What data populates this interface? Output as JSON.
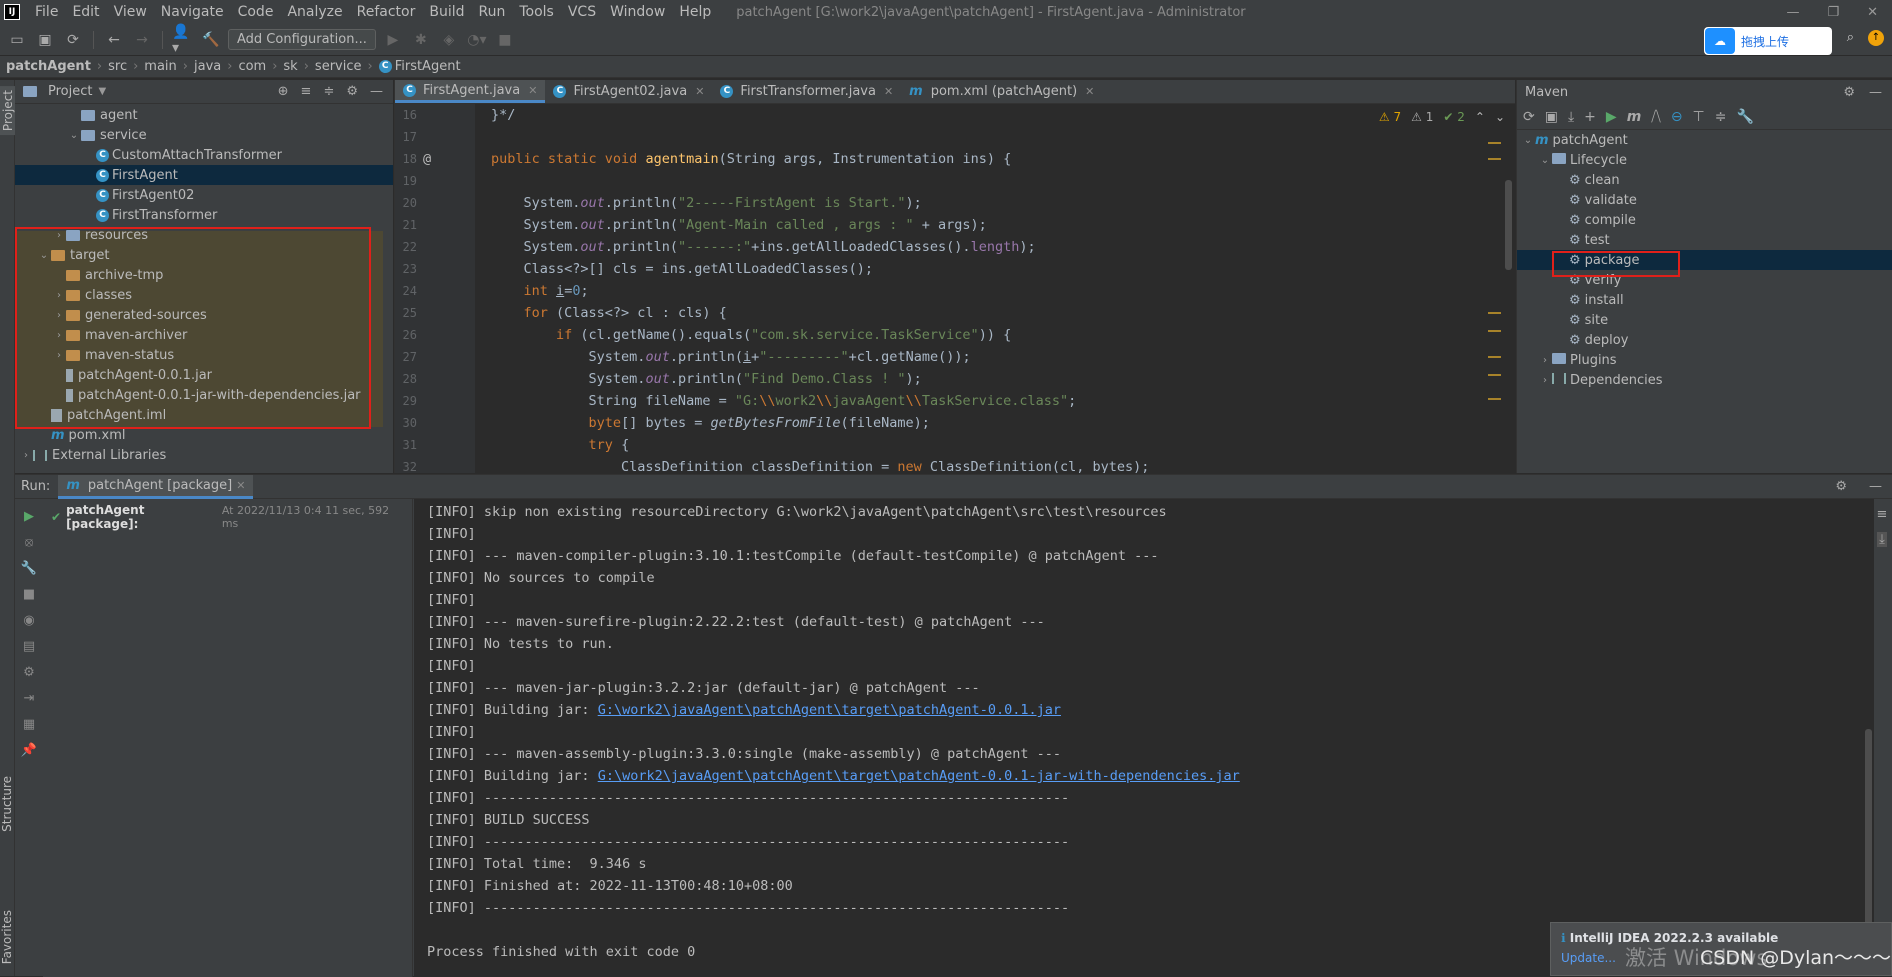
{
  "window": {
    "menu": [
      "File",
      "Edit",
      "View",
      "Navigate",
      "Code",
      "Analyze",
      "Refactor",
      "Build",
      "Run",
      "Tools",
      "VCS",
      "Window",
      "Help"
    ],
    "title": "patchAgent [G:\\work2\\javaAgent\\patchAgent] - FirstAgent.java - Administrator"
  },
  "toolbar": {
    "add_configuration": "Add Configuration...",
    "upload_label": "拖拽上传"
  },
  "breadcrumb": [
    "patchAgent",
    "src",
    "main",
    "java",
    "com",
    "sk",
    "service",
    "FirstAgent"
  ],
  "project": {
    "stripe_label": "Project",
    "title": "Project",
    "tree": [
      {
        "label": "agent",
        "indent": 2,
        "arrow": "",
        "icon": "folder-blue"
      },
      {
        "label": "service",
        "indent": 2,
        "arrow": "v",
        "icon": "folder-blue"
      },
      {
        "label": "CustomAttachTransformer",
        "indent": 3,
        "arrow": "",
        "icon": "class"
      },
      {
        "label": "FirstAgent",
        "indent": 3,
        "arrow": "",
        "icon": "class",
        "selected": true
      },
      {
        "label": "FirstAgent02",
        "indent": 3,
        "arrow": "",
        "icon": "class"
      },
      {
        "label": "FirstTransformer",
        "indent": 3,
        "arrow": "",
        "icon": "class"
      },
      {
        "label": "resources",
        "indent": 1,
        "arrow": ">",
        "icon": "folder-blue"
      },
      {
        "label": "target",
        "indent": 0,
        "arrow": "v",
        "icon": "folder"
      },
      {
        "label": "archive-tmp",
        "indent": 1,
        "arrow": "",
        "icon": "folder"
      },
      {
        "label": "classes",
        "indent": 1,
        "arrow": ">",
        "icon": "folder"
      },
      {
        "label": "generated-sources",
        "indent": 1,
        "arrow": ">",
        "icon": "folder"
      },
      {
        "label": "maven-archiver",
        "indent": 1,
        "arrow": ">",
        "icon": "folder"
      },
      {
        "label": "maven-status",
        "indent": 1,
        "arrow": ">",
        "icon": "folder"
      },
      {
        "label": "patchAgent-0.0.1.jar",
        "indent": 1,
        "arrow": "",
        "icon": "jar"
      },
      {
        "label": "patchAgent-0.0.1-jar-with-dependencies.jar",
        "indent": 1,
        "arrow": "",
        "icon": "jar"
      },
      {
        "label": "patchAgent.iml",
        "indent": 0,
        "arrow": "",
        "icon": "file"
      },
      {
        "label": "pom.xml",
        "indent": 0,
        "arrow": "",
        "icon": "maven"
      },
      {
        "label": "External Libraries",
        "indent": -1,
        "arrow": ">",
        "icon": "lib"
      }
    ]
  },
  "editor": {
    "tabs": [
      {
        "label": "FirstAgent.java",
        "icon": "C",
        "active": true
      },
      {
        "label": "FirstAgent02.java",
        "icon": "C",
        "active": false
      },
      {
        "label": "FirstTransformer.java",
        "icon": "C",
        "active": false
      },
      {
        "label": "pom.xml (patchAgent)",
        "icon": "m",
        "active": false
      }
    ],
    "inspections": {
      "warnings": "7",
      "weak": "1",
      "ok": "2"
    },
    "line_numbers": [
      "16",
      "17",
      "18",
      "19",
      "20",
      "21",
      "22",
      "23",
      "24",
      "25",
      "26",
      "27",
      "28",
      "29",
      "30",
      "31",
      "32"
    ]
  },
  "maven": {
    "title": "Maven",
    "project": "patchAgent",
    "lifecycle_label": "Lifecycle",
    "goals": [
      "clean",
      "validate",
      "compile",
      "test",
      "package",
      "verify",
      "install",
      "site",
      "deploy"
    ],
    "selected_goal": "package",
    "plugins_label": "Plugins",
    "dependencies_label": "Dependencies"
  },
  "run": {
    "label": "Run:",
    "tab": "patchAgent [package]",
    "tree_item": "patchAgent [package]:",
    "tree_time": "At 2022/11/13 0:4 11 sec, 592 ms",
    "console": [
      "[INFO] skip non existing resourceDirectory G:\\work2\\javaAgent\\patchAgent\\src\\test\\resources",
      "[INFO]",
      "[INFO] --- maven-compiler-plugin:3.10.1:testCompile (default-testCompile) @ patchAgent ---",
      "[INFO] No sources to compile",
      "[INFO]",
      "[INFO] --- maven-surefire-plugin:2.22.2:test (default-test) @ patchAgent ---",
      "[INFO] No tests to run.",
      "[INFO]",
      "[INFO] --- maven-jar-plugin:3.2.2:jar (default-jar) @ patchAgent ---",
      "[INFO] Building jar: ",
      "[INFO]",
      "[INFO] --- maven-assembly-plugin:3.3.0:single (make-assembly) @ patchAgent ---",
      "[INFO] Building jar: ",
      "[INFO] ------------------------------------------------------------------------",
      "[INFO] BUILD SUCCESS",
      "[INFO] ------------------------------------------------------------------------",
      "[INFO] Total time:  9.346 s",
      "[INFO] Finished at: 2022-11-13T00:48:10+08:00",
      "[INFO] ------------------------------------------------------------------------",
      "",
      "Process finished with exit code 0"
    ],
    "jar_link_1": "G:\\work2\\javaAgent\\patchAgent\\target\\patchAgent-0.0.1.jar",
    "jar_link_2": "G:\\work2\\javaAgent\\patchAgent\\target\\patchAgent-0.0.1-jar-with-dependencies.jar"
  },
  "side_labels": {
    "structure": "Structure",
    "favorites": "Favorites"
  },
  "notification": {
    "title": "IntelliJ IDEA 2022.2.3 available",
    "action": "Update..."
  },
  "watermark": "激活 Windows",
  "csdn": "CSDN @Dylan～～～",
  "colors": {
    "selection": "#0d293e",
    "accent": "#4a88c7",
    "highlight_box": "#e0201a",
    "excluded_bg": "#4d4833"
  }
}
